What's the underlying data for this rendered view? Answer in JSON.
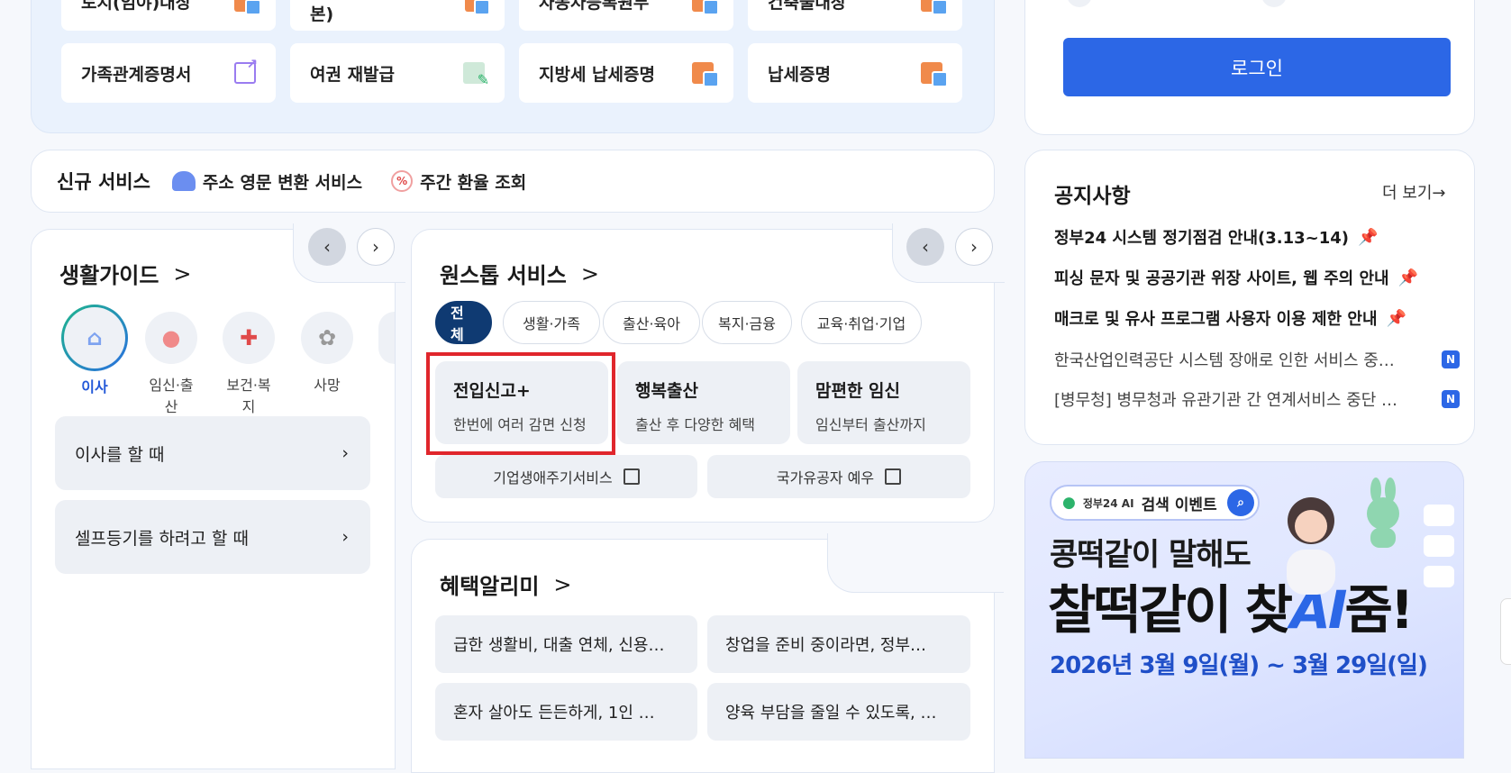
{
  "docs": {
    "row_top": [
      "토지(임야)대장",
      "부동산등기부등본(초본)",
      "자동차등록원부",
      "건축물대장"
    ],
    "row": [
      {
        "label": "가족관계증명서",
        "icon": "external-link-icon"
      },
      {
        "label": "여권 재발급",
        "icon": "edit-form-icon"
      },
      {
        "label": "지방세 납세증명",
        "icon": "pdf-doc-icon"
      },
      {
        "label": "납세증명",
        "icon": "pdf-doc-icon"
      }
    ]
  },
  "new_services": {
    "title": "신규 서비스",
    "items": [
      {
        "label": "주소 영문 변환 서비스",
        "icon": "mailbox-icon"
      },
      {
        "label": "주간 환율 조회",
        "icon": "exchange-rate-icon"
      }
    ]
  },
  "life_guide": {
    "title": "생활가이드",
    "categories": [
      {
        "label": "이사",
        "icon": "house-icon",
        "selected": true
      },
      {
        "label": "임신·출산",
        "icon": "pregnant-icon"
      },
      {
        "label": "보건·복지",
        "icon": "health-cross-icon"
      },
      {
        "label": "사망",
        "icon": "flower-icon"
      }
    ],
    "rows": [
      "이사를 할 때",
      "셀프등기를 하려고 할 때"
    ]
  },
  "one_stop": {
    "title": "원스톱 서비스",
    "chips": [
      "전체",
      "생활·가족",
      "출산·육아",
      "복지·금융",
      "교육·취업·기업"
    ],
    "cards": [
      {
        "title": "전입신고+",
        "desc": "한번에 여러 감면 신청"
      },
      {
        "title": "행복출산",
        "desc": "출산 후 다양한 혜택"
      },
      {
        "title": "맘편한 임신",
        "desc": "임신부터 출산까지"
      }
    ],
    "links": [
      "기업생애주기서비스",
      "국가유공자 예우"
    ]
  },
  "benefit": {
    "title": "혜택알리미",
    "items": [
      "급한 생활비, 대출 연체, 신용…",
      "창업을 준비 중이라면, 정부…",
      "혼자 살아도 든든하게, 1인 …",
      "양육 부담을 줄일 수 있도록, …"
    ]
  },
  "login": {
    "button": "로그인"
  },
  "notice": {
    "title": "공지사항",
    "more": "더 보기→",
    "items": [
      {
        "text": "정부24 시스템 정기점검 안내(3.13~14)",
        "pinned": true
      },
      {
        "text": "피싱 문자 및 공공기관 위장 사이트, 웹 주의 안내",
        "pinned": true
      },
      {
        "text": "매크로 및 유사 프로그램 사용자 이용 제한 안내",
        "pinned": true
      },
      {
        "text": "한국산업인력공단 시스템 장애로 인한 서비스 중…",
        "badge": "N"
      },
      {
        "text": "[병무청] 병무청과 유관기관 간 연계서비스 중단 …",
        "badge": "N"
      }
    ]
  },
  "banner": {
    "pill_brand": "정부24 AI",
    "pill_text": "검색 이벤트",
    "line1": "콩떡같이 말해도",
    "line2_a": "찰떡같이 찾",
    "line2_ai": "AI",
    "line2_b": "줌!",
    "date": "2026년 3월 9일(월) ~ 3월 29일(일)"
  },
  "colors": {
    "primary": "#2c67e6",
    "navy_chip": "#0f3a72",
    "highlight": "#e0262c"
  }
}
